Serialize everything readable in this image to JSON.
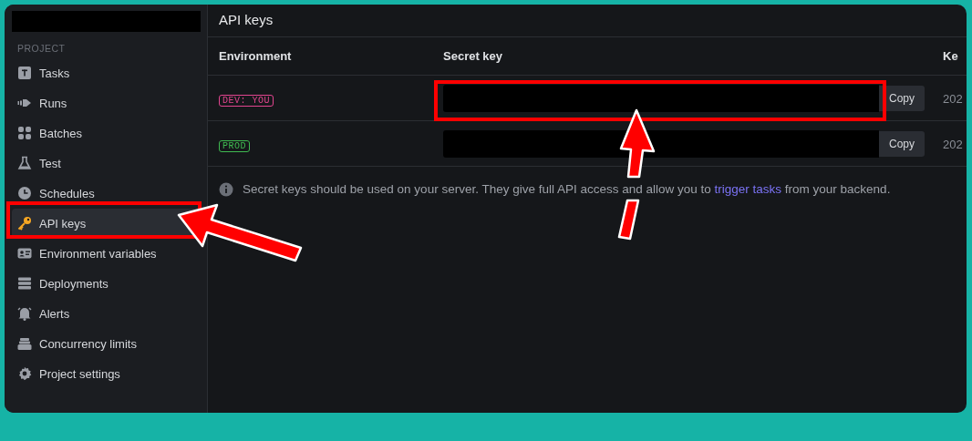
{
  "sidebar": {
    "section": "PROJECT",
    "items": [
      {
        "label": "Tasks",
        "selected": false
      },
      {
        "label": "Runs",
        "selected": false
      },
      {
        "label": "Batches",
        "selected": false
      },
      {
        "label": "Test",
        "selected": false
      },
      {
        "label": "Schedules",
        "selected": false
      },
      {
        "label": "API keys",
        "selected": true
      },
      {
        "label": "Environment variables",
        "selected": false
      },
      {
        "label": "Deployments",
        "selected": false
      },
      {
        "label": "Alerts",
        "selected": false
      },
      {
        "label": "Concurrency limits",
        "selected": false
      },
      {
        "label": "Project settings",
        "selected": false
      }
    ]
  },
  "page": {
    "title": "API keys"
  },
  "table": {
    "columns": [
      "Environment",
      "Secret key",
      "Ke"
    ],
    "rows": [
      {
        "environment": "DEV: YOU",
        "color": "#e2458f",
        "copy": "Copy",
        "column_3": "202"
      },
      {
        "environment": "PROD",
        "color": "#3fb950",
        "copy": "Copy",
        "column_3": "202"
      }
    ]
  },
  "info": {
    "link": "trigger tasks",
    "before": "Secret keys should be used on your server. They give full API access and allow you to ",
    "after": " from your backend."
  }
}
